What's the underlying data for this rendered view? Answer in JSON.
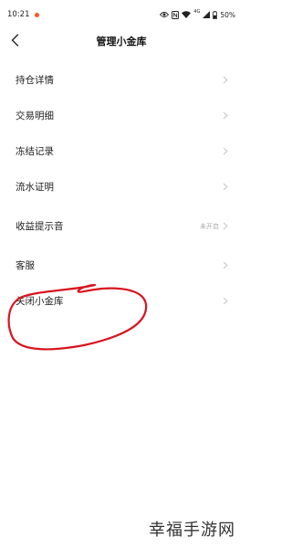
{
  "status_bar": {
    "time": "10:21",
    "signal_badge": "4G",
    "battery": "50%",
    "icons": [
      "eye-icon",
      "nfc-icon",
      "wifi-icon",
      "signal-icon",
      "battery-icon"
    ]
  },
  "header": {
    "title": "管理小金库",
    "back_icon": "chevron-left-icon"
  },
  "menu": {
    "items": [
      {
        "label": "持仓详情",
        "status": ""
      },
      {
        "label": "交易明细",
        "status": ""
      },
      {
        "label": "冻结记录",
        "status": ""
      },
      {
        "label": "流水证明",
        "status": ""
      },
      {
        "label": "收益提示音",
        "status": "未开启"
      },
      {
        "label": "客服",
        "status": ""
      },
      {
        "label": "关闭小金库",
        "status": ""
      }
    ]
  },
  "watermark": "幸福手游网",
  "colors": {
    "annotation": "#d8141e",
    "chevron": "#c4c4c4",
    "status_text": "#aaaaaa",
    "notification_dot": "#ff5722"
  }
}
